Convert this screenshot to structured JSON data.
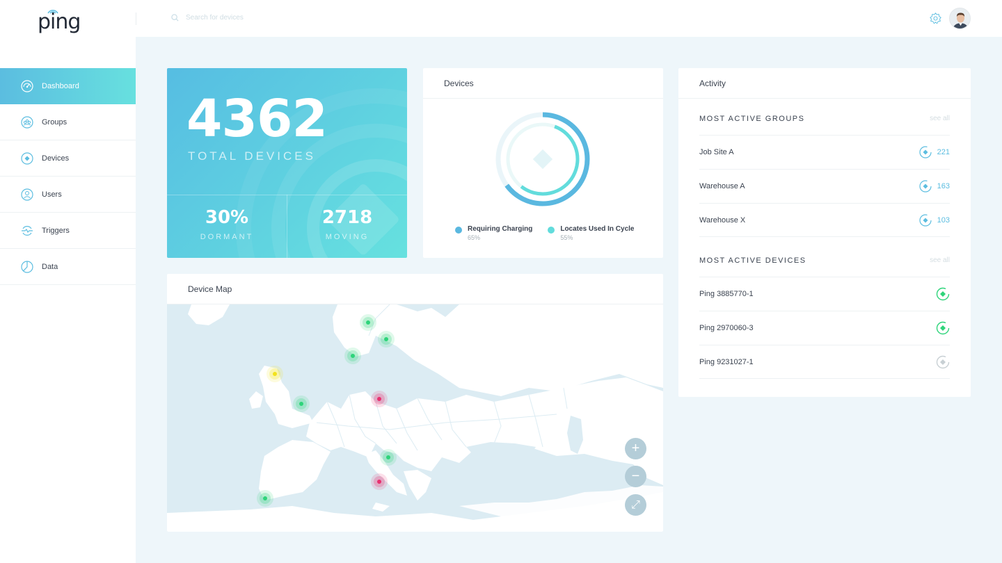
{
  "app": {
    "logo_text": "ping"
  },
  "search": {
    "placeholder": "Search for devices"
  },
  "sidebar": {
    "items": [
      {
        "label": "Dashboard",
        "icon": "gauge-icon"
      },
      {
        "label": "Groups",
        "icon": "group-icon"
      },
      {
        "label": "Devices",
        "icon": "device-icon"
      },
      {
        "label": "Users",
        "icon": "user-icon"
      },
      {
        "label": "Triggers",
        "icon": "trigger-icon"
      },
      {
        "label": "Data",
        "icon": "pie-icon"
      }
    ]
  },
  "stats": {
    "total_value": "4362",
    "total_label": "TOTAL DEVICES",
    "dormant_value": "30%",
    "dormant_label": "DORMANT",
    "moving_value": "2718",
    "moving_label": "MOVING"
  },
  "devices_card": {
    "title": "Devices",
    "legend": [
      {
        "name": "Requiring Charging",
        "value": "65%",
        "fraction": 0.65,
        "color": "#5ab8e0"
      },
      {
        "name": "Locates Used In Cycle",
        "value": "55%",
        "fraction": 0.55,
        "color": "#62dcdc"
      }
    ]
  },
  "map_card": {
    "title": "Device Map",
    "markers": [
      {
        "status": "green"
      },
      {
        "status": "green"
      },
      {
        "status": "green"
      },
      {
        "status": "yellow"
      },
      {
        "status": "green"
      },
      {
        "status": "red"
      },
      {
        "status": "green"
      },
      {
        "status": "red"
      },
      {
        "status": "green"
      }
    ],
    "controls": {
      "zoom_in": "+",
      "zoom_out": "−",
      "fullscreen": "⤢"
    }
  },
  "activity": {
    "title": "Activity",
    "groups_heading": "MOST ACTIVE GROUPS",
    "see_all": "see all",
    "groups": [
      {
        "name": "Job Site A",
        "count": "221"
      },
      {
        "name": "Warehouse A",
        "count": "163"
      },
      {
        "name": "Warehouse X",
        "count": "103"
      }
    ],
    "devices_heading": "MOST ACTIVE DEVICES",
    "devices": [
      {
        "name": "Ping 3885770-1",
        "status": "active",
        "color": "#2ed47a"
      },
      {
        "name": "Ping 2970060-3",
        "status": "active",
        "color": "#2ed47a"
      },
      {
        "name": "Ping 9231027-1",
        "status": "inactive",
        "color": "#c8d0d4"
      }
    ]
  },
  "colors": {
    "accent": "#5bbde0",
    "accent2": "#67e0df",
    "green": "#2ed47a",
    "red": "#e8306f",
    "yellow": "#f2e21c"
  }
}
